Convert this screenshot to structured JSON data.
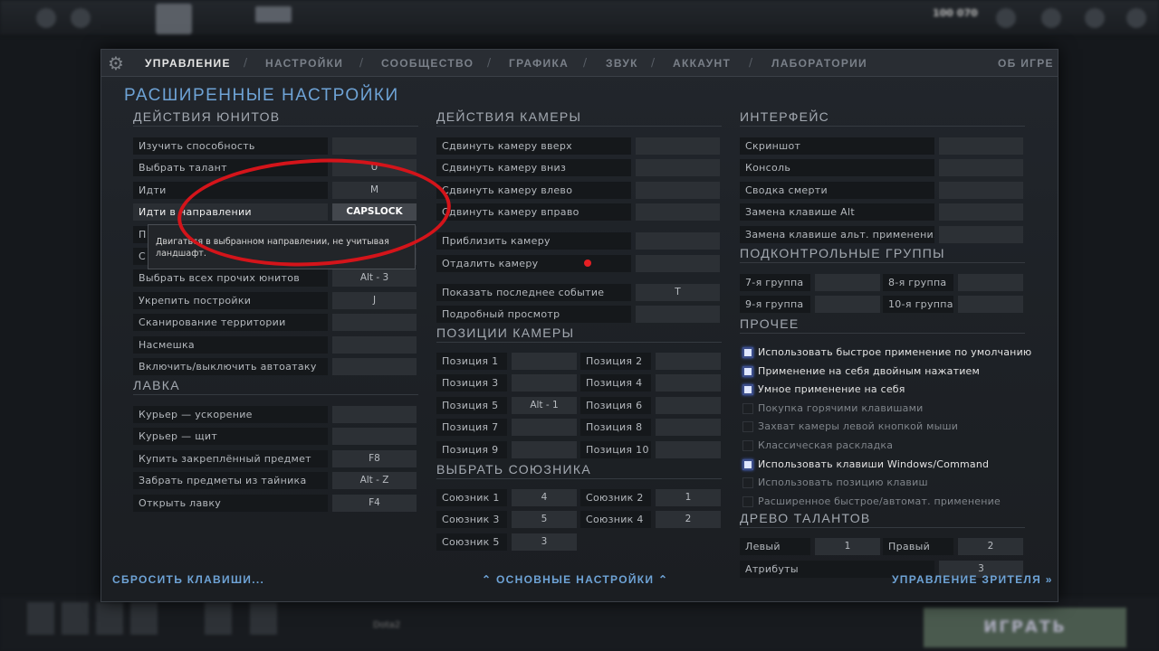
{
  "background": {
    "gold": "100 070",
    "play_label": "ИГРАТЬ",
    "bottom_hint": "Dota2"
  },
  "tabs": [
    {
      "label": "УПРАВЛЕНИЕ"
    },
    {
      "label": "НАСТРОЙКИ"
    },
    {
      "label": "СООБЩЕСТВО"
    },
    {
      "label": "ГРАФИКА"
    },
    {
      "label": "ЗВУК"
    },
    {
      "label": "АККАУНТ"
    },
    {
      "label": "ЛАБОРАТОРИИ"
    },
    {
      "label": "ОБ ИГРЕ"
    }
  ],
  "title": "РАСШИРЕННЫЕ НАСТРОЙКИ",
  "sections": {
    "unit_actions": {
      "title": "ДЕЙСТВИЯ ЮНИТОВ",
      "rows": [
        {
          "label": "Изучить способность",
          "key": ""
        },
        {
          "label": "Выбрать талант",
          "key": "U"
        },
        {
          "label": "Идти",
          "key": "M"
        },
        {
          "label": "Идти в направлении",
          "key": "CAPSLOCK"
        },
        {
          "label": "П",
          "key": ""
        },
        {
          "label": "С",
          "key": ""
        },
        {
          "label": "Выбрать всех прочих юнитов",
          "key": "Alt - 3"
        },
        {
          "label": "Укрепить постройки",
          "key": "J"
        },
        {
          "label": "Сканирование территории",
          "key": ""
        },
        {
          "label": "Насмешка",
          "key": ""
        },
        {
          "label": "Включить/выключить автоатаку",
          "key": ""
        }
      ]
    },
    "shop": {
      "title": "ЛАВКА",
      "rows": [
        {
          "label": "Курьер — ускорение",
          "key": ""
        },
        {
          "label": "Курьер — щит",
          "key": ""
        },
        {
          "label": "Купить закреплённый предмет",
          "key": "F8"
        },
        {
          "label": "Забрать предметы из тайника",
          "key": "Alt - Z"
        },
        {
          "label": "Открыть лавку",
          "key": "F4"
        }
      ]
    },
    "camera_actions": {
      "title": "ДЕЙСТВИЯ КАМЕРЫ",
      "rows": [
        {
          "label": "Сдвинуть камеру вверх",
          "key": ""
        },
        {
          "label": "Сдвинуть камеру вниз",
          "key": ""
        },
        {
          "label": "Сдвинуть камеру влево",
          "key": ""
        },
        {
          "label": "Сдвинуть камеру вправо",
          "key": ""
        },
        {
          "label": "Приблизить камеру",
          "key": ""
        },
        {
          "label": "Отдалить камеру",
          "key": ""
        },
        {
          "label": "Показать последнее событие",
          "key": "T"
        },
        {
          "label": "Подробный просмотр",
          "key": ""
        }
      ]
    },
    "camera_positions": {
      "title": "ПОЗИЦИИ КАМЕРЫ",
      "left": [
        {
          "label": "Позиция 1",
          "key": ""
        },
        {
          "label": "Позиция 3",
          "key": ""
        },
        {
          "label": "Позиция 5",
          "key": "Alt - 1"
        },
        {
          "label": "Позиция 7",
          "key": ""
        },
        {
          "label": "Позиция 9",
          "key": ""
        }
      ],
      "right": [
        {
          "label": "Позиция 2",
          "key": ""
        },
        {
          "label": "Позиция 4",
          "key": ""
        },
        {
          "label": "Позиция 6",
          "key": ""
        },
        {
          "label": "Позиция 8",
          "key": ""
        },
        {
          "label": "Позиция 10",
          "key": ""
        }
      ]
    },
    "select_ally": {
      "title": "ВЫБРАТЬ СОЮЗНИКА",
      "left": [
        {
          "label": "Союзник 1",
          "key": "4"
        },
        {
          "label": "Союзник 3",
          "key": "5"
        },
        {
          "label": "Союзник 5",
          "key": "3"
        }
      ],
      "right": [
        {
          "label": "Союзник 2",
          "key": "1"
        },
        {
          "label": "Союзник 4",
          "key": "2"
        }
      ]
    },
    "interface": {
      "title": "ИНТЕРФЕЙС",
      "rows": [
        {
          "label": "Скриншот",
          "key": ""
        },
        {
          "label": "Консоль",
          "key": ""
        },
        {
          "label": "Сводка смерти",
          "key": ""
        },
        {
          "label": "Замена клавише Alt",
          "key": ""
        },
        {
          "label": "Замена клавише альт. применения",
          "key": ""
        }
      ]
    },
    "control_groups": {
      "title": "ПОДКОНТРОЛЬНЫЕ ГРУППЫ",
      "left": [
        {
          "label": "7-я группа",
          "key": ""
        },
        {
          "label": "9-я группа",
          "key": ""
        }
      ],
      "right": [
        {
          "label": "8-я группа",
          "key": ""
        },
        {
          "label": "10-я группа",
          "key": ""
        }
      ]
    },
    "other": {
      "title": "ПРОЧЕЕ",
      "items": [
        {
          "label": "Использовать быстрое применение по умолчанию",
          "checked": true
        },
        {
          "label": "Применение на себя двойным нажатием",
          "checked": true
        },
        {
          "label": "Умное применение на себя",
          "checked": true
        },
        {
          "label": "Покупка горячими клавишами",
          "checked": false
        },
        {
          "label": "Захват камеры левой кнопкой мыши",
          "checked": false
        },
        {
          "label": "Классическая раскладка",
          "checked": false
        },
        {
          "label": "Использовать клавиши Windows/Command",
          "checked": true
        },
        {
          "label": "Использовать позицию клавиш",
          "checked": false
        },
        {
          "label": "Расширенное быстрое/автомат. применение",
          "checked": false
        }
      ]
    },
    "talent_tree": {
      "title": "ДРЕВО ТАЛАНТОВ",
      "left": {
        "label": "Левый",
        "key": "1"
      },
      "right": {
        "label": "Правый",
        "key": "2"
      },
      "attributes": {
        "label": "Атрибуты",
        "key": "3"
      }
    }
  },
  "tooltip": "Двигаться в выбранном направлении, не учитывая ландшафт.",
  "footer": {
    "reset": "СБРОСИТЬ КЛАВИШИ...",
    "basic": "ОСНОВНЫЕ НАСТРОЙКИ",
    "spectator": "УПРАВЛЕНИЕ ЗРИТЕЛЯ"
  },
  "colors": {
    "accent_blue": "#6ea3d6",
    "annotation_red": "#d4141a",
    "checkbox_on": "#dfe7ff"
  }
}
